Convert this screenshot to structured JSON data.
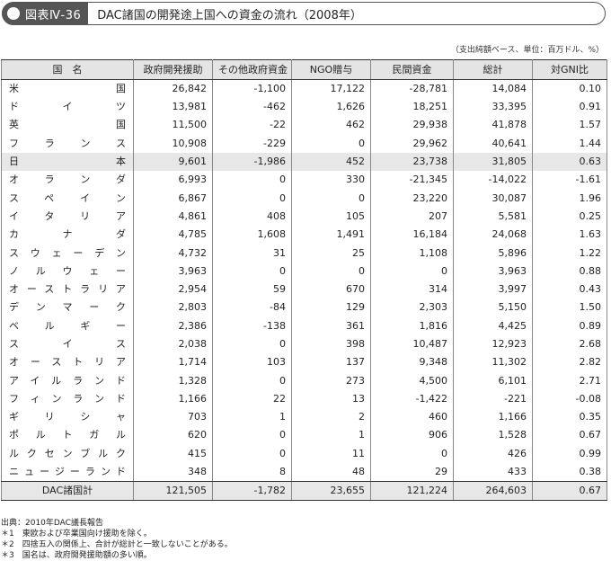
{
  "title": {
    "badge": "図表Ⅳ-36",
    "text": "DAC諸国の開発途上国への資金の流れ（2008年）"
  },
  "unit_note": "（支出純額ベース、単位：百万ドル、%）",
  "table": {
    "headers": [
      "国　名",
      "政府開発援助",
      "その他政府資金",
      "NGO贈与",
      "民間資金",
      "総計",
      "対GNI比"
    ],
    "rows": [
      {
        "country": "米国",
        "values": [
          "26,842",
          "-1,100",
          "17,122",
          "-28,781",
          "14,084",
          "0.10"
        ]
      },
      {
        "country": "ドイツ",
        "values": [
          "13,981",
          "-462",
          "1,626",
          "18,251",
          "33,395",
          "0.91"
        ]
      },
      {
        "country": "英国",
        "values": [
          "11,500",
          "-22",
          "462",
          "29,938",
          "41,878",
          "1.57"
        ]
      },
      {
        "country": "フランス",
        "values": [
          "10,908",
          "-229",
          "0",
          "29,962",
          "40,641",
          "1.44"
        ]
      },
      {
        "country": "日本",
        "values": [
          "9,601",
          "-1,986",
          "452",
          "23,738",
          "31,805",
          "0.63"
        ]
      },
      {
        "country": "オランダ",
        "values": [
          "6,993",
          "0",
          "330",
          "-21,345",
          "-14,022",
          "-1.61"
        ]
      },
      {
        "country": "スペイン",
        "values": [
          "6,867",
          "0",
          "0",
          "23,220",
          "30,087",
          "1.96"
        ]
      },
      {
        "country": "イタリア",
        "values": [
          "4,861",
          "408",
          "105",
          "207",
          "5,581",
          "0.25"
        ]
      },
      {
        "country": "カナダ",
        "values": [
          "4,785",
          "1,608",
          "1,491",
          "16,184",
          "24,068",
          "1.63"
        ]
      },
      {
        "country": "スウェーデン",
        "values": [
          "4,732",
          "31",
          "25",
          "1,108",
          "5,896",
          "1.22"
        ]
      },
      {
        "country": "ノルウェー",
        "values": [
          "3,963",
          "0",
          "0",
          "0",
          "3,963",
          "0.88"
        ]
      },
      {
        "country": "オーストラリア",
        "values": [
          "2,954",
          "59",
          "670",
          "314",
          "3,997",
          "0.43"
        ]
      },
      {
        "country": "デンマーク",
        "values": [
          "2,803",
          "-84",
          "129",
          "2,303",
          "5,150",
          "1.50"
        ]
      },
      {
        "country": "ベルギー",
        "values": [
          "2,386",
          "-138",
          "361",
          "1,816",
          "4,425",
          "0.89"
        ]
      },
      {
        "country": "スイス",
        "values": [
          "2,038",
          "0",
          "398",
          "10,487",
          "12,923",
          "2.68"
        ]
      },
      {
        "country": "オーストリア",
        "values": [
          "1,714",
          "103",
          "137",
          "9,348",
          "11,302",
          "2.82"
        ]
      },
      {
        "country": "アイルランド",
        "values": [
          "1,328",
          "0",
          "273",
          "4,500",
          "6,101",
          "2.71"
        ]
      },
      {
        "country": "フィンランド",
        "values": [
          "1,166",
          "22",
          "13",
          "-1,422",
          "-221",
          "-0.08"
        ]
      },
      {
        "country": "ギリシャ",
        "values": [
          "703",
          "1",
          "2",
          "460",
          "1,166",
          "0.35"
        ]
      },
      {
        "country": "ポルトガル",
        "values": [
          "620",
          "0",
          "1",
          "906",
          "1,528",
          "0.67"
        ]
      },
      {
        "country": "ルクセンブルク",
        "values": [
          "415",
          "0",
          "11",
          "0",
          "426",
          "0.99"
        ]
      },
      {
        "country": "ニュージーランド",
        "values": [
          "348",
          "8",
          "48",
          "29",
          "433",
          "0.38"
        ]
      }
    ],
    "highlight_row": "日本",
    "total": {
      "label": "DAC諸国計",
      "values": [
        "121,505",
        "-1,782",
        "23,655",
        "121,224",
        "264,603",
        "0.67"
      ]
    }
  },
  "notes": [
    "出典：2010年DAC議長報告",
    "＊1　東欧および卒業国向け援助を除く。",
    "＊2　四捨五入の関係上、合計が総計と一致しないことがある。",
    "＊3　国名は、政府開発援助額の多い順。"
  ]
}
